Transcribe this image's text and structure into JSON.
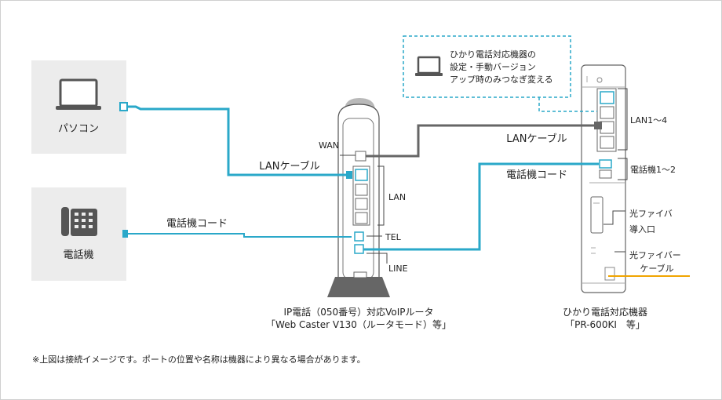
{
  "devices": {
    "pc": {
      "label": "パソコン",
      "icon": "laptop-icon"
    },
    "phone": {
      "label": "電話機",
      "icon": "desk-phone-icon"
    },
    "router": {
      "port_wan": "WAN",
      "port_lan": "LAN",
      "port_tel": "TEL",
      "port_line": "LINE",
      "caption_line1": "IP電話（050番号）対応VoIPルータ",
      "caption_line2": "「Web Caster V130（ルータモード）等」"
    },
    "onu": {
      "lan_ports": "LAN1〜4",
      "tel_ports": "電話機1〜2",
      "fiber_in_1": "光ファイバ",
      "fiber_in_2": "導入口",
      "fiber_cable_1": "光ファイバー",
      "fiber_cable_2": "ケーブル",
      "caption_line1": "ひかり電話対応機器",
      "caption_line2": "「PR-600KI　等」"
    }
  },
  "cables": {
    "lan_pc": "LANケーブル",
    "lan_onu": "LANケーブル",
    "tel_phone": "電話機コード",
    "tel_onu": "電話機コード"
  },
  "callout": {
    "line1": "ひかり電話対応機器の",
    "line2": "設定・手動バージョン",
    "line3": "アップ時のみつなぎ変える"
  },
  "footnote": "※上図は接続イメージです。ポートの位置や名称は機器により異なる場合があります。",
  "colors": {
    "cyan": "#2aa8c9",
    "gray_cable": "#666666",
    "fiber": "#f0a500",
    "panel": "#ececec"
  }
}
